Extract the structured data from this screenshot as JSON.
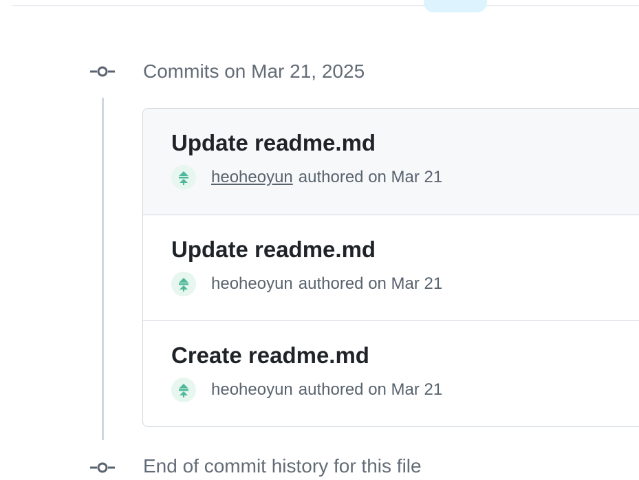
{
  "group": {
    "heading": "Commits on Mar 21, 2025"
  },
  "commits": [
    {
      "title": "Update readme.md",
      "author": "heoheoyun",
      "meta": "authored on Mar 21"
    },
    {
      "title": "Update readme.md",
      "author": "heoheoyun",
      "meta": "authored on Mar 21"
    },
    {
      "title": "Create readme.md",
      "author": "heoheoyun",
      "meta": "authored on Mar 21"
    }
  ],
  "footer": {
    "end_text": "End of commit history for this file"
  },
  "icons": {
    "commit": "git-commit-icon",
    "avatar": "user-avatar-icon"
  },
  "colors": {
    "border": "#d0d7de",
    "muted_text": "#636c76",
    "hover_row": "#f6f8fa",
    "avatar_green": "#4fb89a"
  }
}
